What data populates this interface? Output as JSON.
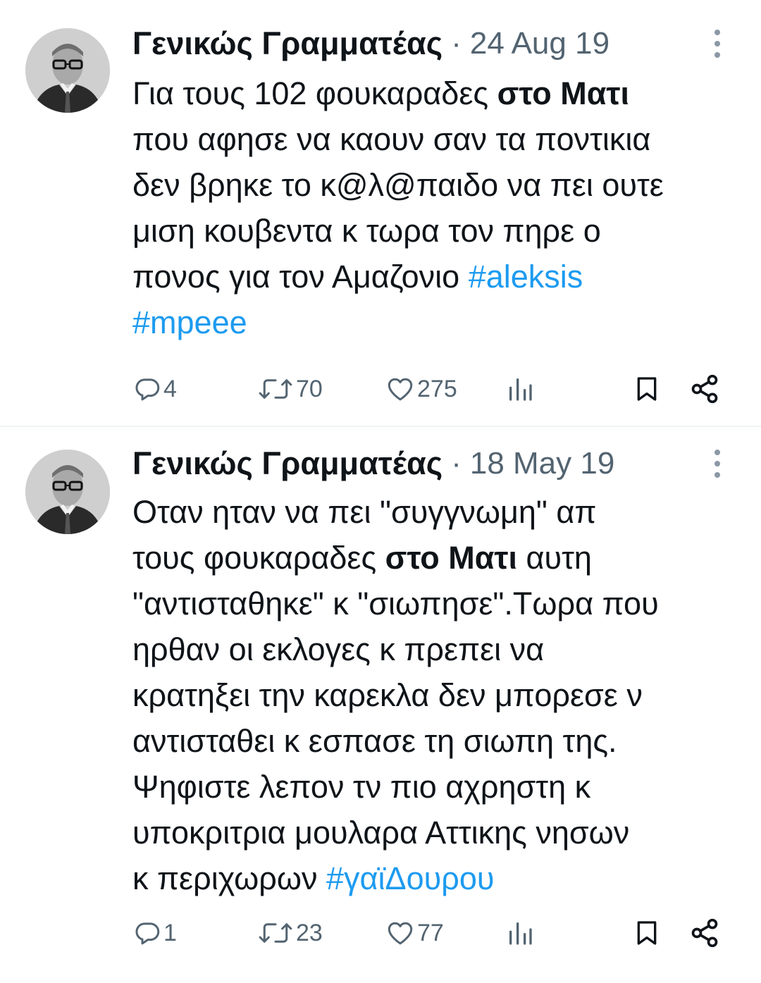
{
  "colors": {
    "text": "#0f1419",
    "secondary": "#536471",
    "hashtag": "#1d9bf0",
    "divider": "#eff3f4"
  },
  "tweets": [
    {
      "author": "Γενικώς Γραμματέας",
      "separator": "·",
      "date": "24 Aug 19",
      "lines": [
        {
          "t1": "Για τους 102 φουκαραδες ",
          "bold": "στο Ματι"
        },
        {
          "t1": "που αφησε να καουν σαν τα ποντικια"
        },
        {
          "t1": "δεν βρηκε το κ@λ@παιδο να πει ουτε"
        },
        {
          "t1": "μιση κουβεντα κ τωρα τον πηρε ο"
        },
        {
          "t1": "πονος για τον Αμαζονιο ",
          "tag": "#aleksis"
        },
        {
          "tag": "#mpeee"
        }
      ],
      "replies": "4",
      "retweets": "70",
      "likes": "275"
    },
    {
      "author": "Γενικώς Γραμματέας",
      "separator": "·",
      "date": "18 May 19",
      "lines": [
        {
          "t1": "Οταν ηταν να πει \"συγγνωμη\" απ"
        },
        {
          "t1": "τους φουκαραδες ",
          "bold": "στο Ματι",
          "t2": " αυτη"
        },
        {
          "t1": "\"αντισταθηκε\" κ \"σιωπησε\".Τωρα που"
        },
        {
          "t1": "ηρθαν οι εκλογες κ πρεπει να"
        },
        {
          "t1": "κρατηξει την καρεκλα δεν μπορεσε ν"
        },
        {
          "t1": "αντισταθει κ εσπασε τη σιωπη της."
        },
        {
          "t1": "Ψηφιστε λεπον τν πιο αχρηστη κ"
        },
        {
          "t1": "υποκριτρια μουλαρα Αττικης νησων"
        },
        {
          "t1": "κ περιχωρων ",
          "tag": "#γαϊΔουρου"
        }
      ],
      "replies": "1",
      "retweets": "23",
      "likes": "77"
    }
  ]
}
